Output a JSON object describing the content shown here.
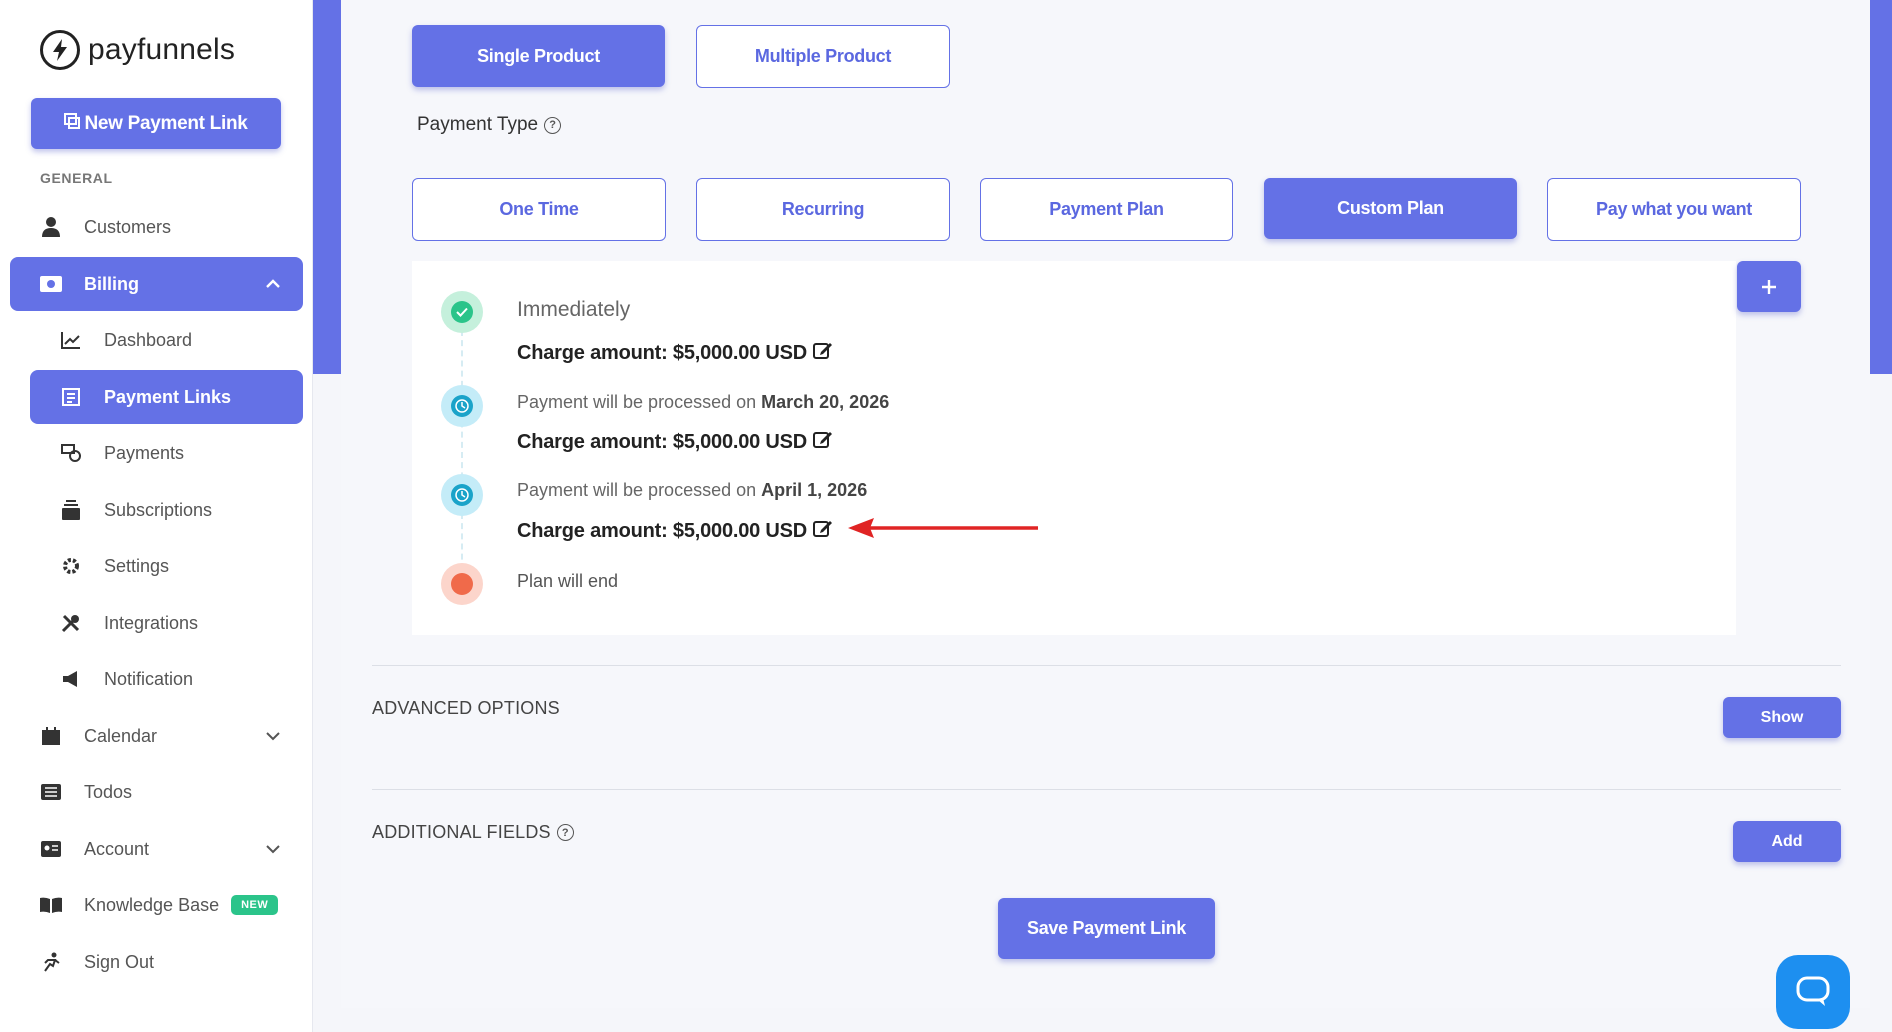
{
  "brand": {
    "name": "payfunnels"
  },
  "sidebar": {
    "new_link_label": "New Payment Link",
    "section_label": "GENERAL",
    "items": [
      {
        "label": "Customers",
        "icon": "user-icon"
      },
      {
        "label": "Billing",
        "icon": "money-icon"
      },
      {
        "label": "Dashboard",
        "icon": "chart-icon"
      },
      {
        "label": "Payment Links",
        "icon": "link-list-icon"
      },
      {
        "label": "Payments",
        "icon": "payments-icon"
      },
      {
        "label": "Subscriptions",
        "icon": "subscriptions-icon"
      },
      {
        "label": "Settings",
        "icon": "gear-icon"
      },
      {
        "label": "Integrations",
        "icon": "tools-icon"
      },
      {
        "label": "Notification",
        "icon": "megaphone-icon"
      },
      {
        "label": "Calendar",
        "icon": "calendar-icon"
      },
      {
        "label": "Todos",
        "icon": "list-icon"
      },
      {
        "label": "Account",
        "icon": "id-card-icon"
      },
      {
        "label": "Knowledge Base",
        "icon": "book-icon",
        "badge": "NEW"
      },
      {
        "label": "Sign Out",
        "icon": "run-icon"
      }
    ]
  },
  "product_tabs": {
    "single": "Single Product",
    "multiple": "Multiple Product"
  },
  "payment_type": {
    "label": "Payment Type",
    "options": [
      "One Time",
      "Recurring",
      "Payment Plan",
      "Custom Plan",
      "Pay what you want"
    ],
    "selected": "Custom Plan"
  },
  "timeline": {
    "first_label": "Immediately",
    "processed_prefix": "Payment will be processed on",
    "charge_text": "Charge amount: $5,000.00 USD",
    "dates": [
      "March 20, 2026",
      "April 1, 2026"
    ],
    "end_label": "Plan will end"
  },
  "advanced": {
    "title": "ADVANCED OPTIONS",
    "button": "Show"
  },
  "additional": {
    "title": "ADDITIONAL FIELDS",
    "button": "Add"
  },
  "save_label": "Save Payment Link",
  "colors": {
    "accent": "#6471e6",
    "success": "#2bc48a",
    "info": "#1aa3c9",
    "end": "#f06a4a",
    "arrow": "#e02424"
  }
}
